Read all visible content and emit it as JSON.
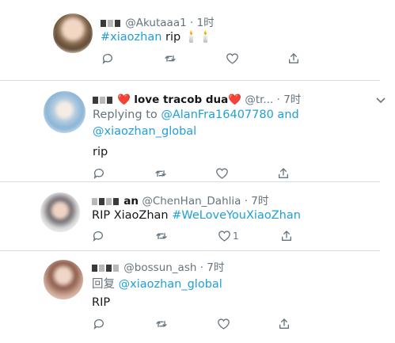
{
  "tweets": [
    {
      "handle": "@Akutaaa1",
      "time": "· 1时",
      "hashtag": "#xiaozhan",
      "text": " rip 🕯️🕯️"
    },
    {
      "name": "love tracob dua",
      "heart1": "❤️",
      "heart2": "❤️",
      "handle": "@tr...",
      "time": "· 7时",
      "reply_prefix": "Replying to ",
      "reply_to1": "@AlanFra16407780",
      "reply_and": " and",
      "reply_to2": "@xiaozhan_global",
      "text": "rip"
    },
    {
      "name_tail": "an",
      "handle": "@ChenHan_Dahlia",
      "time": "· 7时",
      "text": "RIP XiaoZhan ",
      "hashtag": "#WeLoveYouXiaoZhan",
      "like_count": "1"
    },
    {
      "handle": "@bossun_ash",
      "time": "· 7时",
      "reply_prefix": "回复 ",
      "reply_to": "@xiaozhan_global",
      "text": "RIP"
    }
  ],
  "colors": {
    "link": "#1f9fd8",
    "icon": "#65737e",
    "divider": "#d5dde3"
  },
  "icons": [
    "reply-icon",
    "retweet-icon",
    "like-icon",
    "share-icon",
    "chevron-down-icon"
  ]
}
